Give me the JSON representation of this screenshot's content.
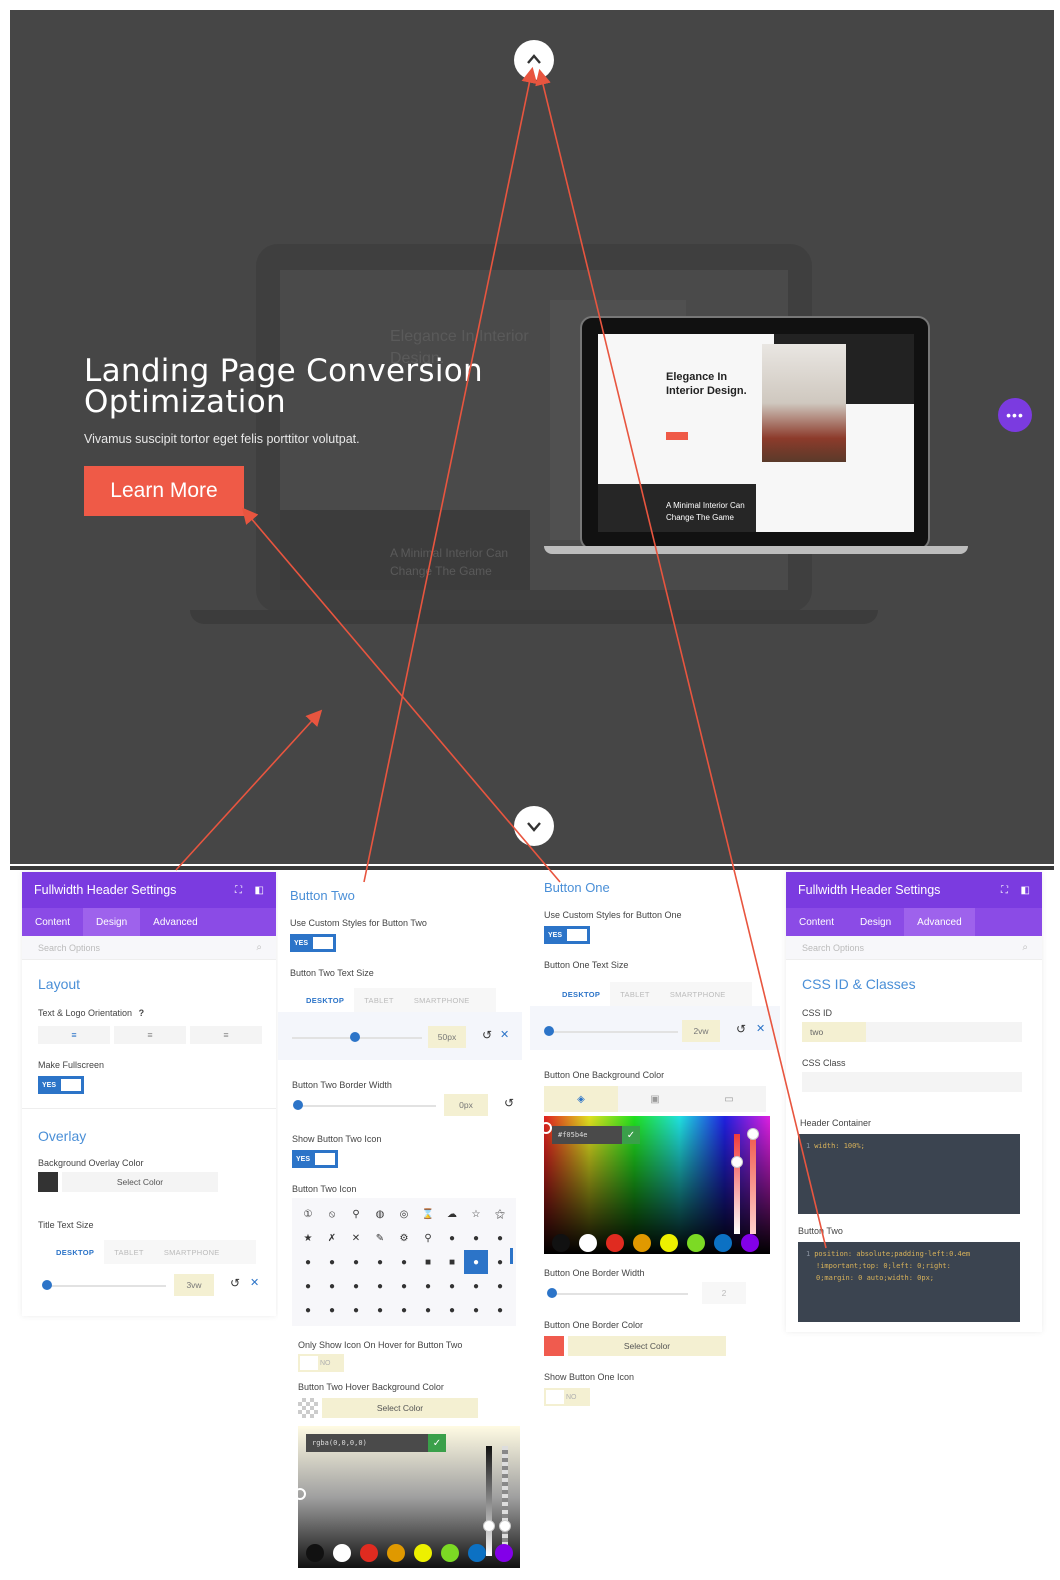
{
  "hero": {
    "title": "Landing Page Conversion Optimization",
    "subtitle": "Vivamus suscipit tortor eget felis porttitor volutpat.",
    "button_label": "Learn More",
    "up_icon": "chevron-up-icon",
    "down_icon": "chevron-down-icon",
    "more_icon": "more-dots-icon",
    "more_glyph": "•••",
    "bg_heading": "Elegance In Interior Design.",
    "bg_caption": "A Minimal Interior Can Change The Game"
  },
  "laptop": {
    "heading": "Elegance In Interior Design.",
    "caption": "A Minimal Interior Can Change The Game"
  },
  "panel_left": {
    "title": "Fullwidth Header Settings",
    "tabs": [
      "Content",
      "Design",
      "Advanced"
    ],
    "active_tab": "Design",
    "search_placeholder": "Search Options",
    "layout_section": "Layout",
    "orientation_label": "Text & Logo Orientation",
    "help": "?",
    "fullscreen_label": "Make Fullscreen",
    "toggle_yes": "YES",
    "overlay_section": "Overlay",
    "overlay_color_label": "Background Overlay Color",
    "overlay_swatch": "#333333",
    "select_color": "Select Color",
    "title_size_label": "Title Text Size",
    "device_tabs": [
      "DESKTOP",
      "TABLET",
      "SMARTPHONE"
    ],
    "title_size_value": "3vw"
  },
  "panel_btn2": {
    "title": "Button Two",
    "custom_styles_label": "Use Custom Styles for Button Two",
    "toggle_yes": "YES",
    "text_size_label": "Button Two Text Size",
    "device_tabs": [
      "DESKTOP",
      "TABLET",
      "SMARTPHONE"
    ],
    "text_size_value": "50px",
    "border_width_label": "Button Two Border Width",
    "border_width_value": "0px",
    "show_icon_label": "Show Button Two Icon",
    "icon_label": "Button Two Icon",
    "icons": [
      "①",
      "⦸",
      "⚲",
      "◍",
      "◎",
      "⌛",
      "☁",
      "☆",
      "⚝",
      "★",
      "✗",
      "✕",
      "✎",
      "⚙",
      "⚲",
      "●",
      "●",
      "●",
      "●",
      "●",
      "●",
      "●",
      "●",
      "■",
      "■",
      "●",
      "●",
      "●",
      "●",
      "●",
      "●",
      "●",
      "●",
      "●",
      "●",
      "●",
      "●",
      "●",
      "●",
      "●",
      "●",
      "●",
      "●",
      "●",
      "●"
    ],
    "selected_icon_index": 25,
    "hover_only_label": "Only Show Icon On Hover for Button Two",
    "toggle_no": "NO",
    "hover_bg_label": "Button Two Hover Background Color",
    "select_color": "Select Color",
    "rgba_value": "rgba(0,0,0,0)",
    "palette": [
      "#111111",
      "#ffffff",
      "#e02b20",
      "#e09900",
      "#edf000",
      "#7cda24",
      "#0c71c3",
      "#8300e9"
    ]
  },
  "panel_btn1": {
    "title": "Button One",
    "custom_styles_label": "Use Custom Styles for Button One",
    "toggle_yes": "YES",
    "text_size_label": "Button One Text Size",
    "device_tabs": [
      "DESKTOP",
      "TABLET",
      "SMARTPHONE"
    ],
    "text_size_value": "2vw",
    "bg_color_label": "Button One Background Color",
    "hex_value": "#f05b4e",
    "palette": [
      "#111111",
      "#ffffff",
      "#e02b20",
      "#e09900",
      "#edf000",
      "#7cda24",
      "#0c71c3",
      "#8300e9"
    ],
    "border_width_label": "Button One Border Width",
    "border_width_value": "2",
    "border_color_label": "Button One Border Color",
    "border_swatch": "#f05b4e",
    "select_color": "Select Color",
    "show_icon_label": "Show Button One Icon",
    "toggle_no": "NO"
  },
  "panel_right": {
    "title": "Fullwidth Header Settings",
    "tabs": [
      "Content",
      "Design",
      "Advanced"
    ],
    "active_tab": "Advanced",
    "search_placeholder": "Search Options",
    "section": "CSS ID & Classes",
    "css_id_label": "CSS ID",
    "css_id_value": "two",
    "css_class_label": "CSS Class",
    "header_container_label": "Header Container",
    "header_container_code": "width: 100%;",
    "button_two_label": "Button Two",
    "button_two_code": [
      "position: absolute;padding-left:0.4em",
      "!important;top: 0;left: 0;right:",
      "0;margin: 0 auto;width: 0px;"
    ]
  },
  "colors": {
    "accent_purple": "#7b3be0",
    "accent_orange": "#ef5a47",
    "hero_bg": "#464646",
    "link_blue": "#4a8fd7"
  }
}
